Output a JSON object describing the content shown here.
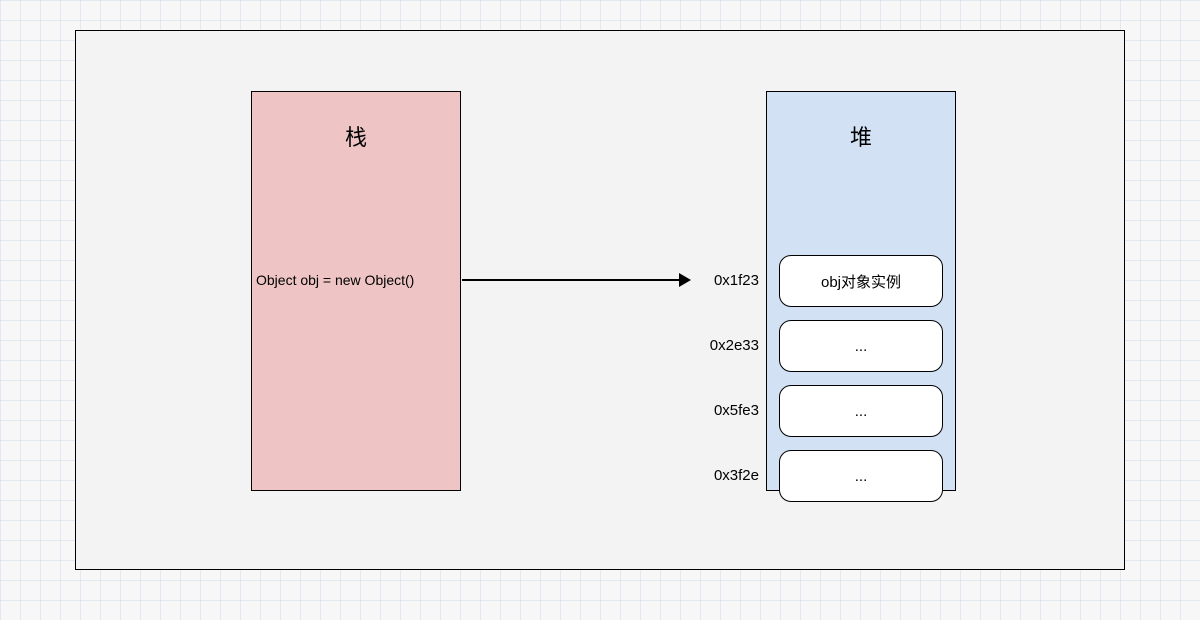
{
  "stack": {
    "title": "栈",
    "code": "Object obj = new Object()"
  },
  "heap": {
    "title": "堆",
    "rows": [
      {
        "address": "0x1f23",
        "label": "obj对象实例"
      },
      {
        "address": "0x2e33",
        "label": "..."
      },
      {
        "address": "0x5fe3",
        "label": "..."
      },
      {
        "address": "0x3f2e",
        "label": "..."
      }
    ]
  }
}
